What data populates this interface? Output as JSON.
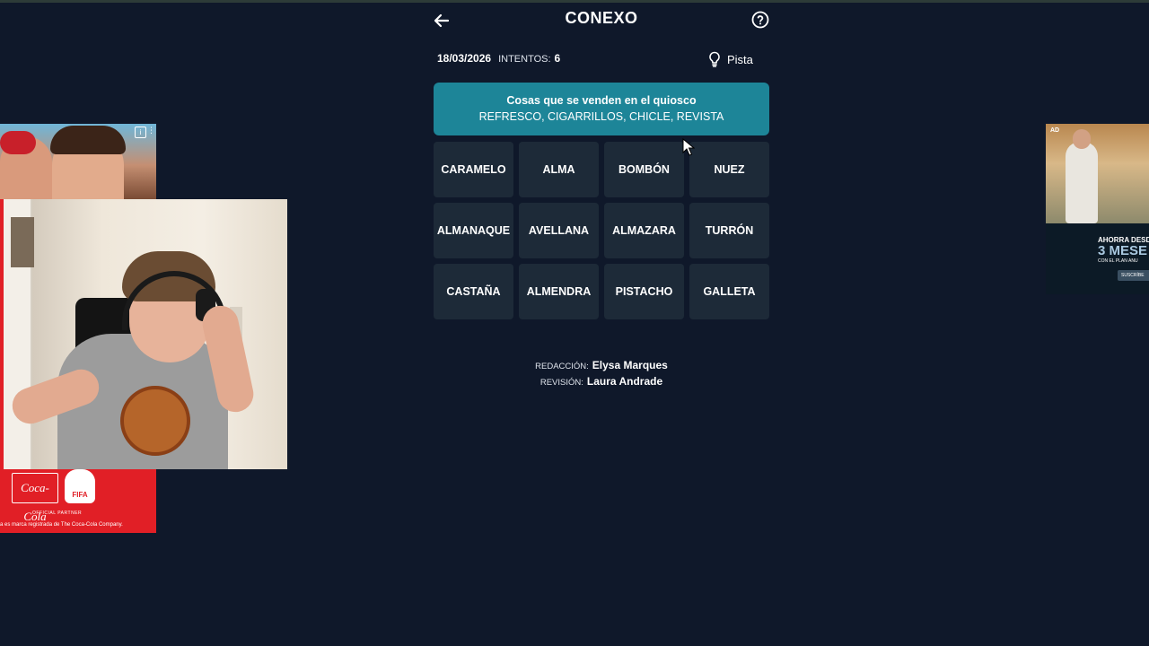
{
  "game": {
    "title": "CONEXO",
    "date": "18/03/2026",
    "attempts_label": "INTENTOS:",
    "attempts_value": "6",
    "hint_label": "Pista",
    "solved_groups": [
      {
        "category": "Cosas que se venden en el quiosco",
        "words": "REFRESCO, CIGARRILLOS, CHICLE, REVISTA",
        "color": "#1d8598"
      }
    ],
    "tiles": [
      "CARAMELO",
      "ALMA",
      "BOMBÓN",
      "NUEZ",
      "ALMANAQUE",
      "AVELLANA",
      "ALMAZARA",
      "TURRÓN",
      "CASTAÑA",
      "ALMENDRA",
      "PISTACHO",
      "GALLETA"
    ],
    "credits": {
      "editor_label": "REDACCIÓN:",
      "editor_name": "Elysa Marques",
      "reviewer_label": "REVISIÓN:",
      "reviewer_name": "Laura Andrade"
    }
  },
  "icons": {
    "back": "arrow-left-icon",
    "help": "question-circle-icon",
    "hint": "lightbulb-icon"
  },
  "ads": {
    "left": {
      "logo_text": "Coca-Cola",
      "fifa_text": "FIFA",
      "partner_text": "OFFICIAL PARTNER",
      "disclaimer": "a es marca registrada de The Coca-Cola Company."
    },
    "right": {
      "tag": "AD",
      "line1": "AHORRA DESD",
      "line2": "3 MESE",
      "line3": "CON EL PLAN ANU",
      "button": "SUSCRÍBE"
    }
  },
  "colors": {
    "background": "#0f182a",
    "tile": "#1d2a38",
    "solved_group": "#1d8598"
  }
}
